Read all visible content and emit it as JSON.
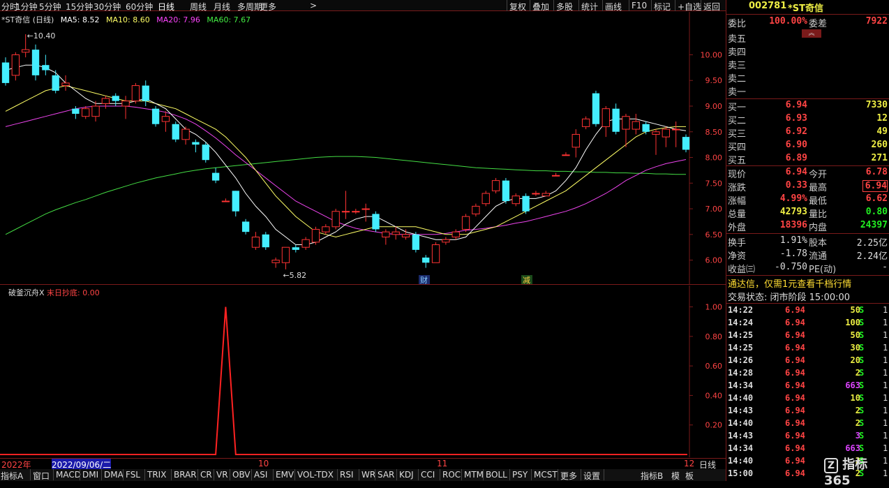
{
  "toolbar": {
    "left_items": [
      "分时",
      "1分钟",
      "5分钟",
      "15分钟",
      "30分钟",
      "60分钟",
      "日线",
      "周线",
      "月线",
      "多周期",
      "更多"
    ],
    "right_items": [
      "复权",
      "叠加",
      "多股",
      "统计",
      "画线",
      "F10",
      "标记",
      "+自选",
      "返回"
    ],
    "active": "日线"
  },
  "main_chart": {
    "title": "*ST奇信 (日线)",
    "ma": [
      {
        "label": "MA5: 8.52",
        "color": "#ffffff"
      },
      {
        "label": "MA10: 8.60",
        "color": "#ffff66"
      },
      {
        "label": "MA20: 7.96",
        "color": "#ff44ff"
      },
      {
        "label": "MA60: 7.67",
        "color": "#44ee44"
      }
    ],
    "y_ticks": [
      "10.00",
      "9.50",
      "9.00",
      "8.50",
      "8.00",
      "7.50",
      "7.00",
      "6.50",
      "6.00"
    ],
    "high_label": "10.40",
    "low_label": "5.82",
    "markers": [
      "财",
      "减"
    ]
  },
  "chart_data": {
    "type": "candlestick",
    "ylim": [
      5.6,
      10.7
    ],
    "candles": [
      [
        9.85,
        9.45,
        9.95,
        9.4
      ],
      [
        9.6,
        10.0,
        10.05,
        9.5
      ],
      [
        10.05,
        10.1,
        10.4,
        9.95
      ],
      [
        10.1,
        9.6,
        10.2,
        9.5
      ],
      [
        9.8,
        9.7,
        10.0,
        9.6
      ],
      [
        9.6,
        9.3,
        9.7,
        9.25
      ],
      [
        9.4,
        9.45,
        9.6,
        9.3
      ],
      [
        8.95,
        8.85,
        9.0,
        8.75
      ],
      [
        8.8,
        8.95,
        9.0,
        8.75
      ],
      [
        8.8,
        9.0,
        9.1,
        8.7
      ],
      [
        9.05,
        9.15,
        9.2,
        8.95
      ],
      [
        9.2,
        9.1,
        9.25,
        9.0
      ],
      [
        9.0,
        9.1,
        9.2,
        8.75
      ],
      [
        9.1,
        9.4,
        9.45,
        9.05
      ],
      [
        9.4,
        9.1,
        9.5,
        9.0
      ],
      [
        8.95,
        8.65,
        9.0,
        8.6
      ],
      [
        8.7,
        8.8,
        8.9,
        8.5
      ],
      [
        8.65,
        8.35,
        8.7,
        8.3
      ],
      [
        8.35,
        8.55,
        8.6,
        8.25
      ],
      [
        8.3,
        8.25,
        8.35,
        8.1
      ],
      [
        8.25,
        7.95,
        8.3,
        7.9
      ],
      [
        7.7,
        7.55,
        7.8,
        7.5
      ],
      [
        7.15,
        7.15,
        7.2,
        7.15
      ],
      [
        7.35,
        6.95,
        7.35,
        6.85
      ],
      [
        6.75,
        6.55,
        6.8,
        6.5
      ],
      [
        6.25,
        6.45,
        6.55,
        6.2
      ],
      [
        6.5,
        6.25,
        6.55,
        6.2
      ],
      [
        5.95,
        6.0,
        6.05,
        5.85
      ],
      [
        5.95,
        6.25,
        6.25,
        5.82
      ],
      [
        6.25,
        6.2,
        6.3,
        6.15
      ],
      [
        6.25,
        6.4,
        6.45,
        6.2
      ],
      [
        6.35,
        6.6,
        6.65,
        6.3
      ],
      [
        6.55,
        6.65,
        6.7,
        6.5
      ],
      [
        6.65,
        6.95,
        7.0,
        6.6
      ],
      [
        6.95,
        6.95,
        7.35,
        6.8
      ],
      [
        6.95,
        6.95,
        7.0,
        6.9
      ],
      [
        7.0,
        7.0,
        7.1,
        6.75
      ],
      [
        6.9,
        6.6,
        6.95,
        6.55
      ],
      [
        6.45,
        6.55,
        6.6,
        6.3
      ],
      [
        6.5,
        6.55,
        6.65,
        6.4
      ],
      [
        6.45,
        6.5,
        6.6,
        6.4
      ],
      [
        6.5,
        6.2,
        6.55,
        6.15
      ],
      [
        6.05,
        5.95,
        6.1,
        5.85
      ],
      [
        5.95,
        6.3,
        6.35,
        5.95
      ],
      [
        6.35,
        6.4,
        6.45,
        6.3
      ],
      [
        6.45,
        6.55,
        6.6,
        6.4
      ],
      [
        6.6,
        6.85,
        6.9,
        6.55
      ],
      [
        6.9,
        7.05,
        7.1,
        6.85
      ],
      [
        7.1,
        7.3,
        7.35,
        7.05
      ],
      [
        7.35,
        7.55,
        7.6,
        7.3
      ],
      [
        7.55,
        7.15,
        7.6,
        7.1
      ],
      [
        7.1,
        7.25,
        7.3,
        7.05
      ],
      [
        7.25,
        6.95,
        7.3,
        6.9
      ],
      [
        7.3,
        7.3,
        7.35,
        7.25
      ],
      [
        7.25,
        7.3,
        7.35,
        7.25
      ],
      [
        7.65,
        7.65,
        7.7,
        7.65
      ],
      [
        8.05,
        8.05,
        8.1,
        8.05
      ],
      [
        8.2,
        8.45,
        8.55,
        8.0
      ],
      [
        8.6,
        8.75,
        8.8,
        8.55
      ],
      [
        9.25,
        8.65,
        9.3,
        8.6
      ],
      [
        8.6,
        8.95,
        9.0,
        8.4
      ],
      [
        8.95,
        8.5,
        9.05,
        8.45
      ],
      [
        8.55,
        8.8,
        8.85,
        8.2
      ],
      [
        8.55,
        8.7,
        8.85,
        8.45
      ],
      [
        8.65,
        8.5,
        8.7,
        8.45
      ],
      [
        8.45,
        8.5,
        8.55,
        8.05
      ],
      [
        8.4,
        8.55,
        8.6,
        8.2
      ],
      [
        8.55,
        8.55,
        8.7,
        8.2
      ],
      [
        8.4,
        8.15,
        8.45,
        8.1
      ]
    ],
    "ma5": [
      9.7,
      9.75,
      9.8,
      9.8,
      9.75,
      9.65,
      9.45,
      9.3,
      9.15,
      9.05,
      9.05,
      9.05,
      9.05,
      9.1,
      9.15,
      9.05,
      8.95,
      8.75,
      8.55,
      8.45,
      8.3,
      8.1,
      7.85,
      7.6,
      7.3,
      7.05,
      6.85,
      6.6,
      6.45,
      6.3,
      6.3,
      6.35,
      6.45,
      6.55,
      6.7,
      6.8,
      6.85,
      6.85,
      6.75,
      6.65,
      6.55,
      6.5,
      6.45,
      6.4,
      6.4,
      6.4,
      6.45,
      6.65,
      6.85,
      7.05,
      7.15,
      7.2,
      7.2,
      7.2,
      7.25,
      7.35,
      7.55,
      7.8,
      8.15,
      8.45,
      8.7,
      8.75,
      8.75,
      8.75,
      8.7,
      8.65,
      8.6,
      8.55,
      8.52
    ],
    "ma10": [
      8.9,
      9.0,
      9.1,
      9.2,
      9.3,
      9.35,
      9.4,
      9.35,
      9.3,
      9.25,
      9.2,
      9.15,
      9.1,
      9.1,
      9.1,
      9.05,
      9.0,
      8.95,
      8.85,
      8.75,
      8.65,
      8.55,
      8.4,
      8.2,
      8.0,
      7.75,
      7.5,
      7.25,
      7.05,
      6.85,
      6.7,
      6.55,
      6.5,
      6.45,
      6.5,
      6.55,
      6.6,
      6.65,
      6.65,
      6.65,
      6.65,
      6.65,
      6.6,
      6.55,
      6.5,
      6.5,
      6.5,
      6.55,
      6.6,
      6.65,
      6.75,
      6.85,
      6.95,
      7.05,
      7.15,
      7.25,
      7.35,
      7.5,
      7.65,
      7.8,
      7.95,
      8.1,
      8.25,
      8.4,
      8.5,
      8.55,
      8.58,
      8.6,
      8.6
    ],
    "ma20": [
      8.6,
      8.65,
      8.7,
      8.75,
      8.8,
      8.85,
      8.9,
      8.95,
      8.98,
      9.0,
      9.0,
      9.0,
      9.0,
      8.98,
      8.95,
      8.92,
      8.88,
      8.82,
      8.75,
      8.65,
      8.52,
      8.38,
      8.22,
      8.05,
      7.9,
      7.75,
      7.6,
      7.45,
      7.3,
      7.15,
      7.05,
      6.95,
      6.85,
      6.75,
      6.68,
      6.62,
      6.58,
      6.55,
      6.52,
      6.5,
      6.5,
      6.5,
      6.5,
      6.5,
      6.52,
      6.55,
      6.58,
      6.6,
      6.62,
      6.65,
      6.68,
      6.72,
      6.75,
      6.8,
      6.85,
      6.9,
      6.95,
      7.02,
      7.1,
      7.2,
      7.3,
      7.42,
      7.55,
      7.65,
      7.75,
      7.82,
      7.88,
      7.92,
      7.96
    ],
    "ma60": [
      6.5,
      6.6,
      6.7,
      6.8,
      6.9,
      6.98,
      7.05,
      7.12,
      7.18,
      7.25,
      7.32,
      7.38,
      7.44,
      7.5,
      7.55,
      7.6,
      7.64,
      7.68,
      7.72,
      7.75,
      7.78,
      7.8,
      7.82,
      7.84,
      7.86,
      7.88,
      7.9,
      7.92,
      7.94,
      7.96,
      7.98,
      8.0,
      8.01,
      8.02,
      8.02,
      8.02,
      8.01,
      8.0,
      7.98,
      7.96,
      7.94,
      7.92,
      7.9,
      7.88,
      7.86,
      7.84,
      7.82,
      7.8,
      7.79,
      7.78,
      7.77,
      7.76,
      7.75,
      7.74,
      7.74,
      7.73,
      7.73,
      7.72,
      7.72,
      7.71,
      7.71,
      7.7,
      7.7,
      7.69,
      7.69,
      7.68,
      7.68,
      7.67,
      7.67
    ],
    "indicator": {
      "name": "破釜沉舟X",
      "series_name": "末日抄底",
      "value": "0.00",
      "spike_index": 22,
      "spike_value": 1.0,
      "ylim": [
        0,
        1.05
      ],
      "y_ticks": [
        "1.00",
        "0.80",
        "0.60",
        "0.40",
        "0.20"
      ]
    }
  },
  "date_axis": {
    "labels": [
      "2022年",
      "2022/09/06/二",
      "10",
      "11",
      "12"
    ],
    "period": "日线"
  },
  "bottom_tabs": [
    "指标A",
    "窗口",
    "MACD",
    "DMI",
    "DMA",
    "FSL",
    "TRIX",
    "BRAR",
    "CR",
    "VR",
    "OBV",
    "ASI",
    "EMV",
    "VOL-TDX",
    "RSI",
    "WR",
    "SAR",
    "KDJ",
    "CCI",
    "ROC",
    "MTM",
    "BOLL",
    "PSY",
    "MCST",
    "更多",
    "设置"
  ],
  "bottom_right_tabs": [
    "指标B",
    "模",
    "板"
  ],
  "right_panel": {
    "code": "002781",
    "name": "*ST奇信",
    "weibi_label": "委比",
    "weibi": "100.00%",
    "weicha_label": "委差",
    "weicha": "7922",
    "sell": [
      {
        "label": "卖五"
      },
      {
        "label": "卖四"
      },
      {
        "label": "卖三"
      },
      {
        "label": "卖二"
      },
      {
        "label": "卖一"
      }
    ],
    "buy": [
      {
        "label": "买一",
        "price": "6.94",
        "vol": "7330"
      },
      {
        "label": "买二",
        "price": "6.93",
        "vol": "12"
      },
      {
        "label": "买三",
        "price": "6.92",
        "vol": "49"
      },
      {
        "label": "买四",
        "price": "6.90",
        "vol": "260"
      },
      {
        "label": "买五",
        "price": "6.89",
        "vol": "271"
      }
    ],
    "stats": [
      {
        "l1": "现价",
        "v1": "6.94",
        "c1": "red",
        "l2": "今开",
        "v2": "6.78",
        "c2": "red"
      },
      {
        "l1": "涨跌",
        "v1": "0.33",
        "c1": "red",
        "l2": "最高",
        "v2": "6.94",
        "c2": "red"
      },
      {
        "l1": "涨幅",
        "v1": "4.99%",
        "c1": "red",
        "l2": "最低",
        "v2": "6.62",
        "c2": "red"
      },
      {
        "l1": "总量",
        "v1": "42793",
        "c1": "yellow",
        "l2": "量比",
        "v2": "0.80",
        "c2": "green"
      },
      {
        "l1": "外盘",
        "v1": "18396",
        "c1": "red",
        "l2": "内盘",
        "v2": "24397",
        "c2": "green"
      }
    ],
    "stats2": [
      {
        "l1": "换手",
        "v1": "1.91%",
        "l2": "股本",
        "v2": "2.25亿"
      },
      {
        "l1": "净资",
        "v1": "-1.78",
        "l2": "流通",
        "v2": "2.24亿"
      },
      {
        "l1": "收益㈢",
        "v1": "-0.750",
        "l2": "PE(动)",
        "v2": "-"
      }
    ],
    "promo": "通达信，仅需1元查看千档行情",
    "trade_status": "交易状态: 闭市阶段 15:00:00",
    "ticks": [
      {
        "t": "14:22",
        "p": "6.94",
        "v": "50",
        "c": "yellow"
      },
      {
        "t": "14:24",
        "p": "6.94",
        "v": "100",
        "c": "yellow"
      },
      {
        "t": "14:25",
        "p": "6.94",
        "v": "50",
        "c": "yellow"
      },
      {
        "t": "14:25",
        "p": "6.94",
        "v": "30",
        "c": "yellow"
      },
      {
        "t": "14:26",
        "p": "6.94",
        "v": "20",
        "c": "yellow"
      },
      {
        "t": "14:28",
        "p": "6.94",
        "v": "2",
        "c": "yellow"
      },
      {
        "t": "14:34",
        "p": "6.94",
        "v": "663",
        "c": "magenta"
      },
      {
        "t": "14:40",
        "p": "6.94",
        "v": "10",
        "c": "yellow"
      },
      {
        "t": "14:43",
        "p": "6.94",
        "v": "2",
        "c": "yellow"
      },
      {
        "t": "14:40",
        "p": "6.94",
        "v": "2",
        "c": "yellow"
      },
      {
        "t": "14:43",
        "p": "6.94",
        "v": "3",
        "c": "magenta"
      },
      {
        "t": "14:34",
        "p": "6.94",
        "v": "663",
        "c": "magenta"
      },
      {
        "t": "14:40",
        "p": "6.94",
        "v": "2",
        "c": "yellow"
      },
      {
        "t": "15:00",
        "p": "6.94",
        "v": "2",
        "c": "yellow"
      }
    ],
    "tick_flag": "S",
    "tick_count": "1",
    "watermark": "指标365"
  }
}
